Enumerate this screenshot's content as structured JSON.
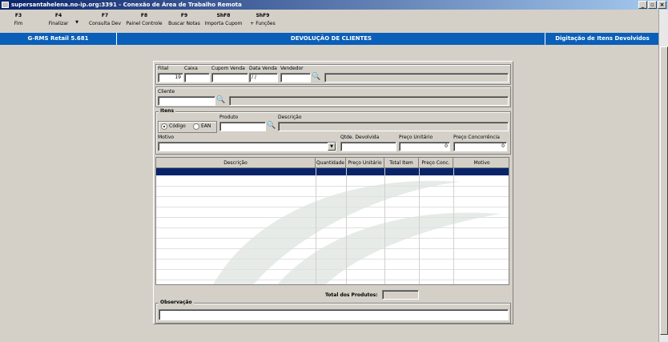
{
  "window": {
    "title": "supersantahelena.no-ip.org:3391 - Conexão de Área de Trabalho Remota"
  },
  "toolbar": [
    {
      "key": "F3",
      "label": "Fim"
    },
    {
      "key": "F4",
      "label": "Finalizar"
    },
    {
      "key": "F7",
      "label": "Consulta Dev"
    },
    {
      "key": "F8",
      "label": "Painel Controle"
    },
    {
      "key": "F9",
      "label": "Buscar Notas"
    },
    {
      "key": "ShF8",
      "label": "Importa Cupom"
    },
    {
      "key": "ShF9",
      "label": "+ Funções"
    }
  ],
  "header": {
    "app": "G-RMS Retail 5.681",
    "title": "DEVOLUÇÃO DE CLIENTES",
    "mode": "Digitação de Itens Devolvidos"
  },
  "venda": {
    "filial_label": "Filial",
    "filial_value": "19",
    "caixa_label": "Caixa",
    "cupom_label": "Cupom Venda",
    "data_label": "Data Venda",
    "data_value": " / /",
    "vendedor_label": "Vendedor"
  },
  "cliente": {
    "label": "Cliente"
  },
  "itens": {
    "group_label": "Itens",
    "radio_codigo": "Código",
    "radio_ean": "EAN",
    "produto_label": "Produto",
    "descricao_label": "Descrição",
    "motivo_label": "Motivo",
    "qtde_label": "Qtde. Devolvida",
    "preco_label": "Preço Unitário",
    "preco_value": "0",
    "concorrencia_label": "Preço Concorrência",
    "concorrencia_value": "0"
  },
  "grid": {
    "columns": [
      "Descrição",
      "Quantidade",
      "Preço Unitário",
      "Total Item",
      "Preço Conc.",
      "Motivo"
    ]
  },
  "totais": {
    "label": "Total dos Produtos:"
  },
  "observacao": {
    "label": "Observação"
  }
}
